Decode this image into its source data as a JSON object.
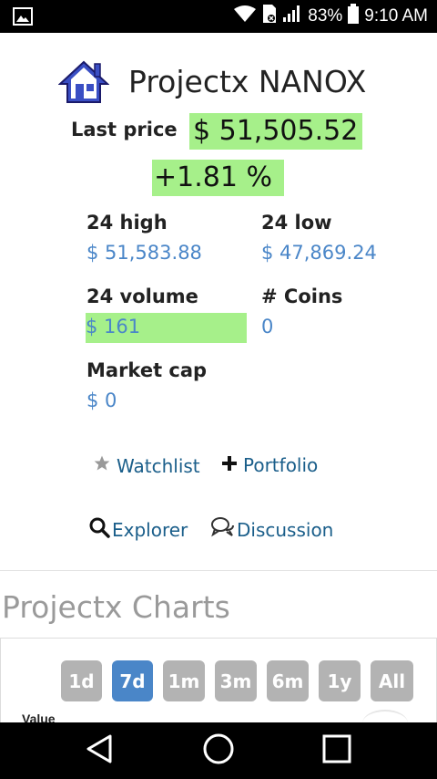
{
  "status_bar": {
    "battery": "83%",
    "time": "9:10 AM"
  },
  "header": {
    "title": "Projectx NANOX"
  },
  "price": {
    "last_price_label": "Last price",
    "last_price": "$ 51,505.52",
    "change": "+1.81 %"
  },
  "stats": {
    "high_label": "24 high",
    "high_value": "$ 51,583.88",
    "low_label": "24 low",
    "low_value": "$ 47,869.24",
    "volume_label": "24 volume",
    "volume_value": "$ 161",
    "coins_label": "# Coins",
    "coins_value": "0",
    "marketcap_label": "Market cap",
    "marketcap_value": "$ 0"
  },
  "actions": {
    "watchlist": "Watchlist",
    "portfolio": "Portfolio",
    "explorer": "Explorer",
    "discussion": "Discussion"
  },
  "charts": {
    "title": "Projectx Charts",
    "ranges": [
      "1d",
      "7d",
      "1m",
      "3m",
      "6m",
      "1y",
      "All"
    ],
    "active_range": "7d",
    "value_label": "Value"
  },
  "colors": {
    "highlight": "#a6f08a",
    "link": "#4a86c8",
    "active_button": "#4a86c8",
    "inactive_button": "#b3b3b3"
  }
}
